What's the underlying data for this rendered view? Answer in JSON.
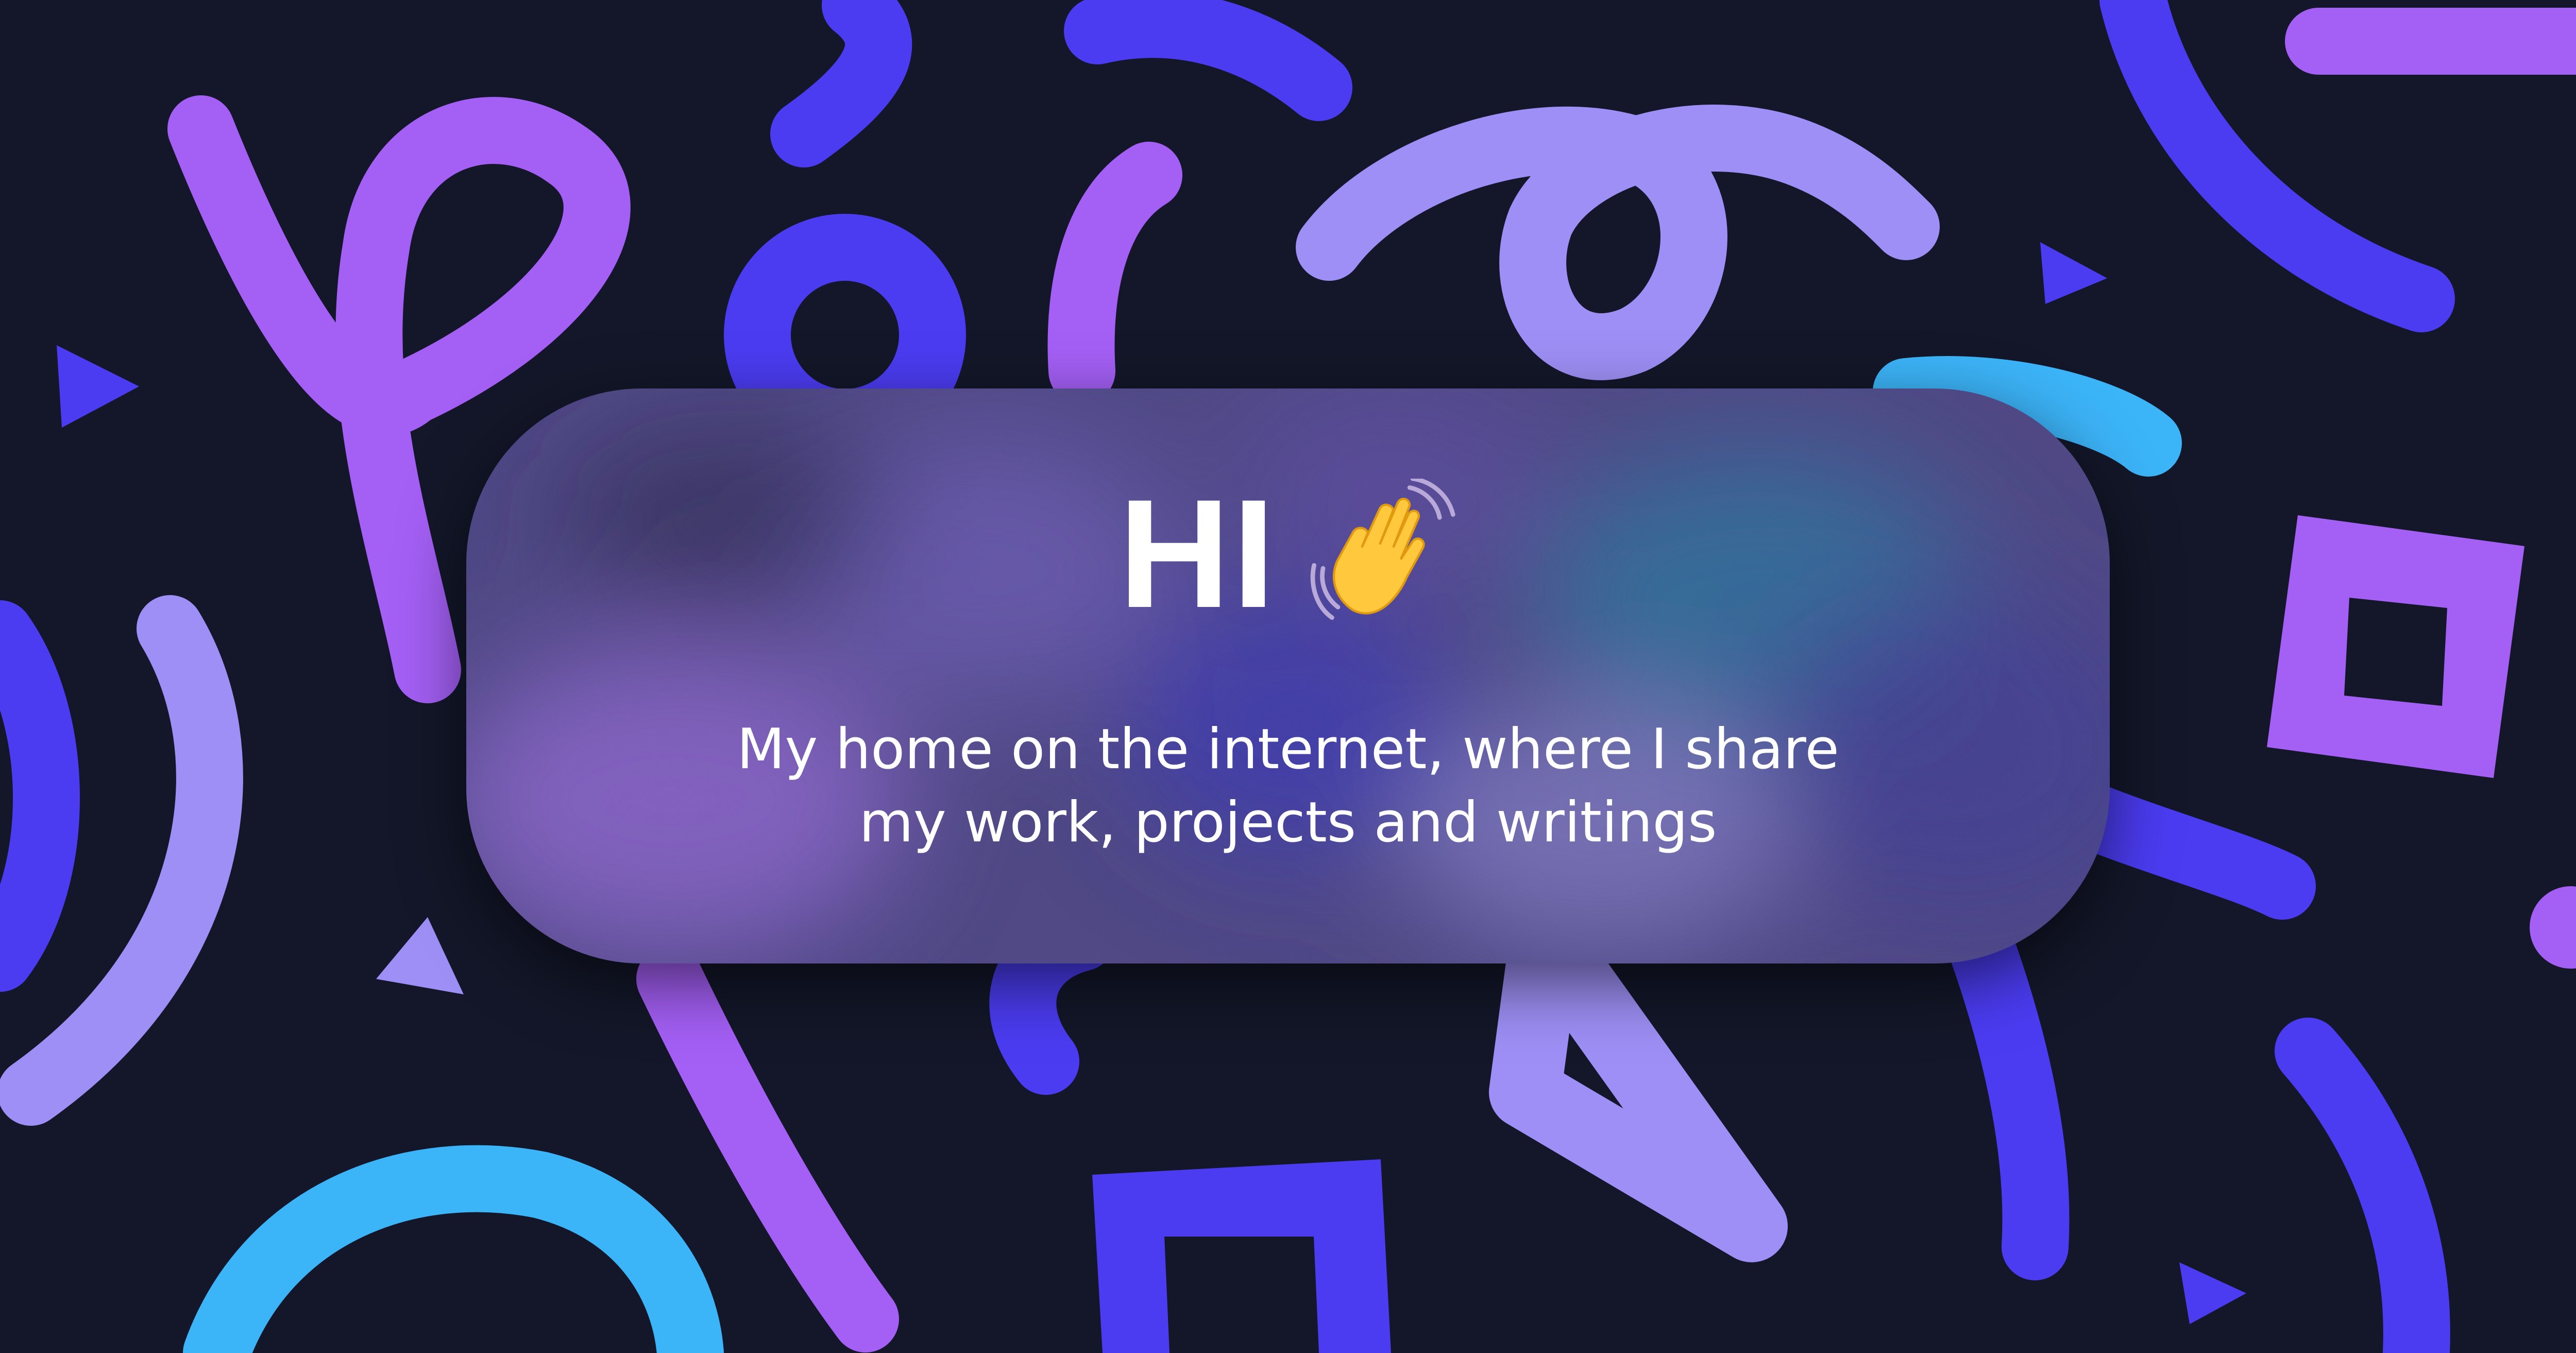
{
  "hero": {
    "title": "HI",
    "title_icon": "waving-hand-icon",
    "tagline_line1": "My home on the internet, where I share",
    "tagline_line2": "my work, projects and writings"
  },
  "colors": {
    "background": "#131729",
    "purple": "#a45ff5",
    "lavender": "#9d8ff5",
    "indigo": "#4b3cf2",
    "sky": "#3cb4f8",
    "text": "#ffffff"
  }
}
